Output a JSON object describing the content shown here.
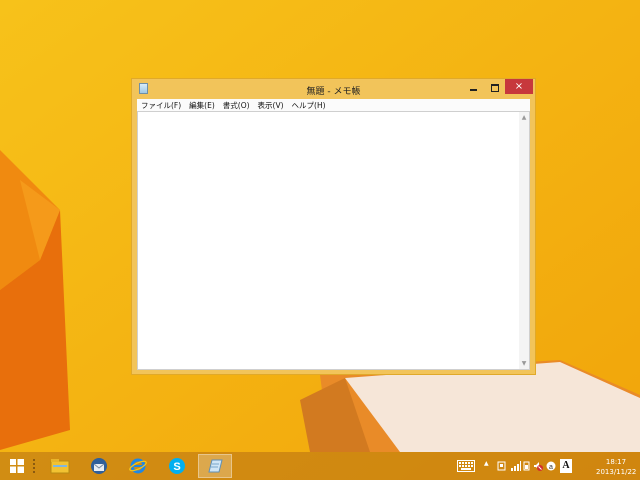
{
  "window": {
    "title": "無題 - メモ帳",
    "close_glyph": "×",
    "menu": [
      "ファイル(F)",
      "編集(E)",
      "書式(O)",
      "表示(V)",
      "ヘルプ(H)"
    ],
    "text": ""
  },
  "scrollbar": {
    "up": "▲",
    "down": "▼"
  },
  "taskbar": {
    "pinned": [
      "explorer-icon",
      "thunderbird-icon",
      "ie-icon",
      "skype-icon",
      "notepad-icon"
    ],
    "tray_chevron": "▲",
    "ime_label": "A",
    "clock_time": "18:17",
    "clock_date": "2013/11/22"
  },
  "colors": {
    "desktop": "#f5b800",
    "close_button": "#c7383c",
    "skype": "#00aff0",
    "ie": "#1e88e5"
  }
}
